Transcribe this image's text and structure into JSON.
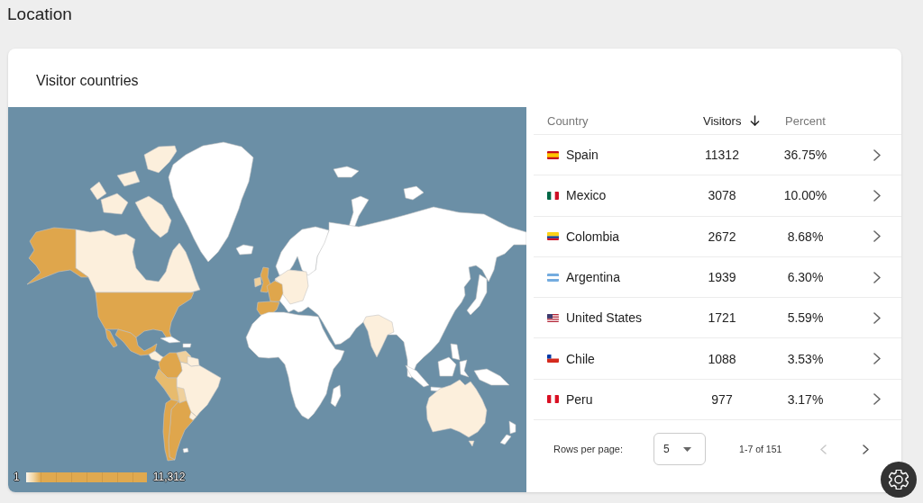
{
  "page": {
    "title": "Location"
  },
  "card": {
    "title": "Visitor countries"
  },
  "map": {
    "legend": {
      "min": "1",
      "max": "11,312"
    }
  },
  "table": {
    "columns": [
      {
        "label": "Country",
        "sorted": false
      },
      {
        "label": "Visitors",
        "sorted": true
      },
      {
        "label": "Percent",
        "sorted": false
      }
    ],
    "rows": [
      {
        "kind": "es",
        "country": "Spain",
        "visitors": "11312",
        "percent": "36.75%"
      },
      {
        "kind": "mx",
        "country": "Mexico",
        "visitors": "3078",
        "percent": "10.00%"
      },
      {
        "kind": "co",
        "country": "Colombia",
        "visitors": "2672",
        "percent": "8.68%"
      },
      {
        "kind": "ar",
        "country": "Argentina",
        "visitors": "1939",
        "percent": "6.30%"
      },
      {
        "kind": "us",
        "country": "United States",
        "visitors": "1721",
        "percent": "5.59%"
      },
      {
        "kind": "cl",
        "country": "Chile",
        "visitors": "1088",
        "percent": "3.53%"
      },
      {
        "kind": "pe",
        "country": "Peru",
        "visitors": "977",
        "percent": "3.17%"
      }
    ]
  },
  "pagination": {
    "label": "Rows per page:",
    "rows_per_page": "5",
    "range": "1-7 of 151",
    "buttons": [
      {
        "kind": "prev",
        "disabled": true
      },
      {
        "kind": "next",
        "disabled": false
      }
    ]
  }
}
